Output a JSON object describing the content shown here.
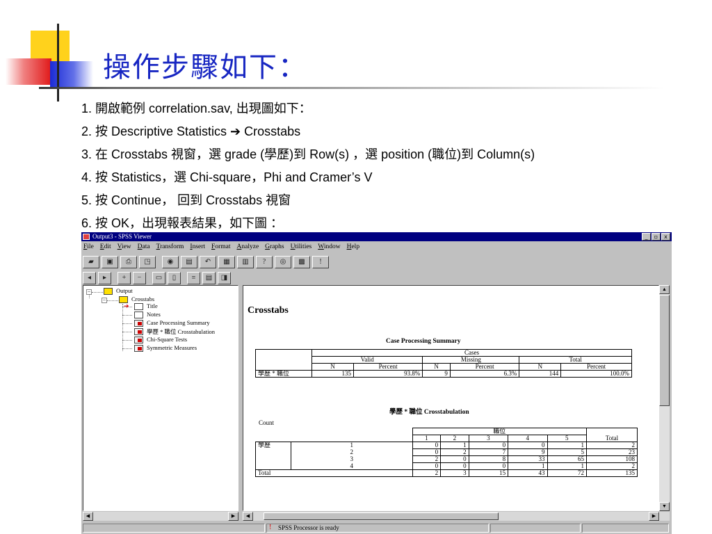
{
  "slide": {
    "title": "操作步驟如下：",
    "steps": [
      "1. 開啟範例 correlation.sav, 出現圖如下：",
      "2. 按 Descriptive Statistics ➔ Crosstabs",
      "3. 在 Crosstabs 視窗，選 grade (學歷)到 Row(s) ，選 position (職位)到 Column(s)",
      "4. 按 Statistics，選 Chi-square，Phi and Cramer’s V",
      "5. 按 Continue， 回到 Crosstabs 視窗",
      "6. 按 OK，出現報表結果，如下圖 ："
    ]
  },
  "window": {
    "title": "Output3 - SPSS Viewer",
    "controls": [
      "_",
      "▫",
      "x"
    ]
  },
  "menu": [
    "File",
    "Edit",
    "View",
    "Data",
    "Transform",
    "Insert",
    "Format",
    "Analyze",
    "Graphs",
    "Utilities",
    "Window",
    "Help"
  ],
  "tree": {
    "root": "Output",
    "group": "Crosstabs",
    "items": [
      "Title",
      "Notes",
      "Case Processing Summary",
      "學歷 * 職位 Crosstabulation",
      "Chi-Square Tests",
      "Symmetric Measures"
    ],
    "expand_symbol": "−"
  },
  "content": {
    "heading": "Crosstabs",
    "summary": {
      "title": "Case Processing Summary",
      "cases": "Cases",
      "groups": [
        "Valid",
        "Missing",
        "Total"
      ],
      "subheaders": [
        "N",
        "Percent",
        "N",
        "Percent",
        "N",
        "Percent"
      ],
      "row_label": "學歷 * 職位",
      "row_values": [
        "135",
        "93.8%",
        "9",
        "6.3%",
        "144",
        "100.0%"
      ]
    },
    "crosstab": {
      "title": "學歷 * 職位 Crosstabulation",
      "count_label": "Count",
      "col_var": "職位",
      "col_headers": [
        "1",
        "2",
        "3",
        "4",
        "5"
      ],
      "total_label": "Total",
      "row_var": "學歷",
      "rows": [
        {
          "label": "1",
          "values": [
            "0",
            "1",
            "0",
            "0",
            "1"
          ],
          "total": "2"
        },
        {
          "label": "2",
          "values": [
            "0",
            "2",
            "7",
            "9",
            "5"
          ],
          "total": "23"
        },
        {
          "label": "3",
          "values": [
            "2",
            "0",
            "8",
            "33",
            "65"
          ],
          "total": "108"
        },
        {
          "label": "4",
          "values": [
            "0",
            "0",
            "0",
            "1",
            "1"
          ],
          "total": "2"
        }
      ],
      "total_row": {
        "label": "Total",
        "values": [
          "2",
          "3",
          "15",
          "43",
          "72"
        ],
        "total": "135"
      }
    }
  },
  "status": {
    "text": "SPSS Processor  is ready",
    "icon": "!"
  },
  "colors": {
    "title_blue": "#1726c2",
    "titlebar": "#000080",
    "chrome": "#c0c0c0"
  }
}
